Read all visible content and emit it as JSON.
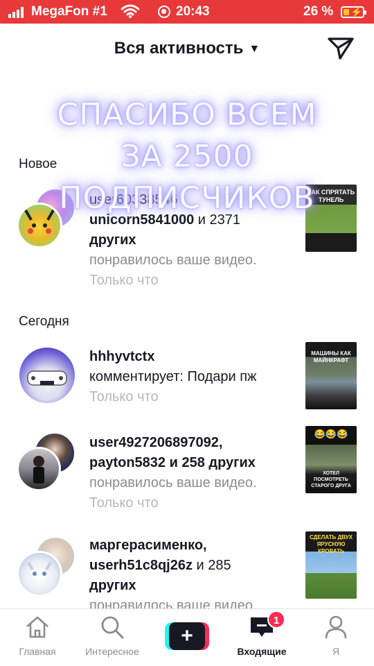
{
  "status_bar": {
    "carrier": "MegaFon #1",
    "time": "20:43",
    "battery_percent": "26 %",
    "icons": [
      "signal-icon",
      "wifi-icon",
      "screen-record-icon",
      "battery-charging-icon"
    ]
  },
  "header": {
    "title": "Вся активность",
    "dropdown_icon": "caret-down-icon",
    "send_icon": "direct-message-icon"
  },
  "overlay": {
    "lines": [
      "СПАСИБО ВСЕМ",
      "ЗА 2500",
      "ПОДПИСЧИКОВ"
    ]
  },
  "sections": {
    "new": "Новое",
    "today": "Сегодня"
  },
  "notifications": [
    {
      "line1": "user60338546",
      "line2_bold": "unicorn5841000",
      "line2_rest": " и 2371",
      "line3": "других",
      "action": "понравилось ваше видео.",
      "time": "Только что",
      "thumb_text": "КАК СПРЯТАТЬ ТУНЕЛЬ"
    },
    {
      "line1": "hhhyvtctx",
      "action": "комментирует: Подари пж",
      "time": "Только что",
      "thumb_text": "МАШИНЫ КАК МАЙНКРАФТ"
    },
    {
      "line1": "user4927206897092,",
      "line2_bold": "payton5832",
      "line2_rest": " и 258 других",
      "action": "понравилось ваше видео.",
      "time": "Только что",
      "thumb_emoji": "😂😂😂",
      "thumb_text": "ХОТЕЛ ПОСМОТРЕТЬ СТАРОГО ДРУГА"
    },
    {
      "line1": "маргерасименко,",
      "line2_bold": "userh51c8qj26z",
      "line2_rest": " и 285",
      "line3": "других",
      "action": "понравилось ваше видео.",
      "thumb_text": "СДЕЛАТЬ ДВУХ ЯРУСНУЮ КРОВАТЬ"
    }
  ],
  "bottom_nav": {
    "home": "Главная",
    "discover": "Интересное",
    "create": "+",
    "inbox": "Входящие",
    "inbox_badge": "1",
    "profile": "Я"
  }
}
